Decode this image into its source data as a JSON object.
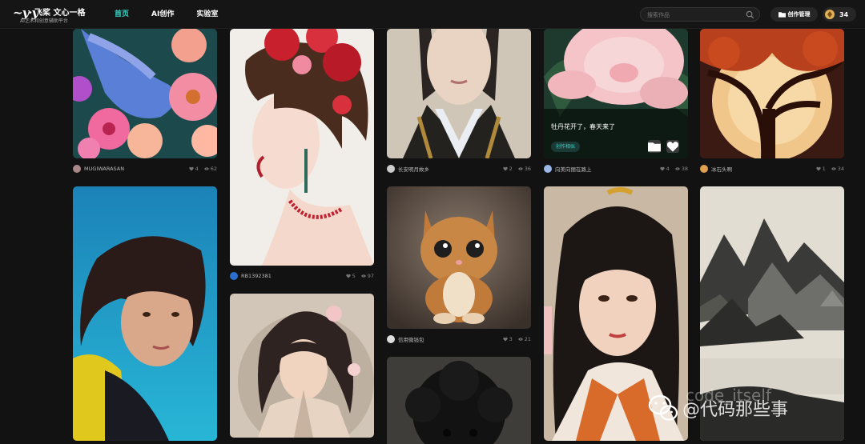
{
  "header": {
    "logo_mark": "yiyi",
    "logo_title": "飞桨 文心一格",
    "logo_subtitle": "AI艺术和创意辅助平台",
    "nav": [
      "首页",
      "AI创作",
      "实验室"
    ],
    "search_placeholder": "搜索作品",
    "manage_label": "创作管理",
    "credits": "34"
  },
  "cards": [
    {
      "title": "",
      "user": "MUGIWARASAN",
      "likes": "4",
      "views": "62"
    },
    {
      "title": "",
      "user": "",
      "likes": "",
      "views": ""
    },
    {
      "title": "",
      "user": "RB1392381",
      "likes": "5",
      "views": "97"
    },
    {
      "title": "",
      "user": "",
      "likes": "",
      "views": ""
    },
    {
      "title": "",
      "user": "长安明月故乡",
      "likes": "2",
      "views": "36"
    },
    {
      "title": "",
      "user": "信用微钱包",
      "likes": "3",
      "views": "21"
    },
    {
      "title": "",
      "user": "",
      "likes": "",
      "views": ""
    },
    {
      "title": "牡丹花开了，春天来了",
      "user": "向美向丽在路上",
      "likes": "4",
      "views": "38",
      "tag": "创作相似"
    },
    {
      "title": "",
      "user": "",
      "likes": "",
      "views": ""
    },
    {
      "title": "",
      "user": "冰石头啊",
      "likes": "1",
      "views": "34"
    },
    {
      "title": "",
      "user": "",
      "likes": "",
      "views": ""
    }
  ],
  "watermark": {
    "main": "@代码那些事",
    "secondary": "code_itself"
  },
  "colors": {
    "accent": "#35d6c9",
    "coin": "#e0b156"
  }
}
